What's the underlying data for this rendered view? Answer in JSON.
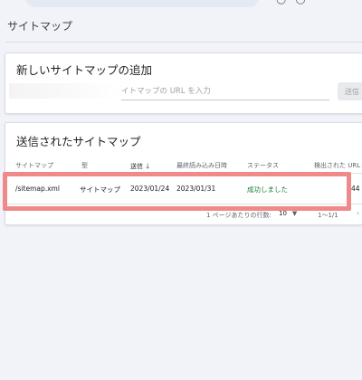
{
  "page": {
    "title": "サイトマップ"
  },
  "add_card": {
    "title": "新しいサイトマップの追加",
    "url_placeholder": "イトマップの URL を入力",
    "submit_label": "送信"
  },
  "list_card": {
    "title": "送信されたサイトマップ",
    "columns": [
      "サイトマップ",
      "型",
      "送信",
      "最終読み込み日時",
      "ステータス",
      "検出された URL"
    ],
    "rows": [
      {
        "sitemap": "/sitemap.xml",
        "type": "サイトマップ",
        "submitted": "2023/01/24",
        "last_read": "2023/01/31",
        "status": "成功しました",
        "urls_found": "44"
      }
    ],
    "pagination": {
      "rows_per_page_label": "1 ページあたりの行数:",
      "rows_per_page_value": "10",
      "range": "1〜1/1"
    }
  },
  "colors": {
    "status_success": "#188038",
    "highlight_outline": "#f08a8a",
    "background": "#f1f3f9"
  },
  "icons": {
    "sort": "arrow-down-icon",
    "rows_dropdown": "caret-down-icon",
    "prev_page": "chevron-left-icon"
  }
}
